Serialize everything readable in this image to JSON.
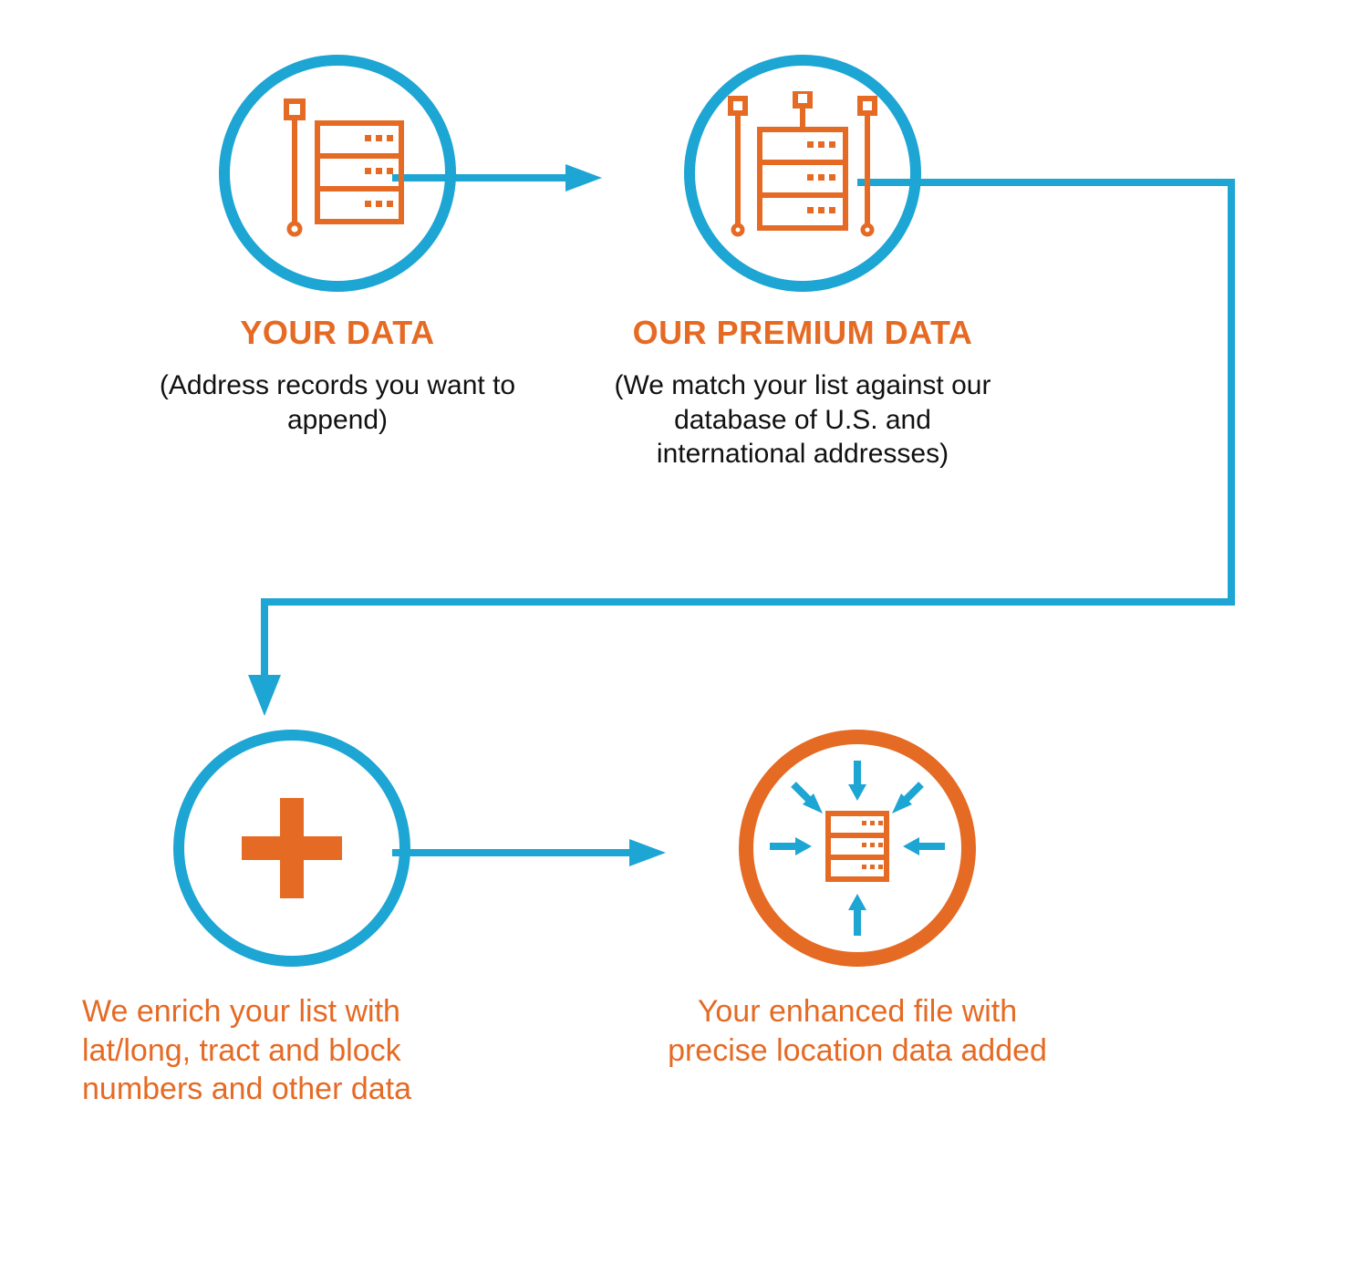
{
  "colors": {
    "blue": "#1DA5D4",
    "orange": "#E56A24",
    "black": "#111111"
  },
  "steps": [
    {
      "id": "your-data",
      "title": "YOUR DATA",
      "subtitle": "(Address records you want to append)",
      "icon": "server-single",
      "circle_color": "blue"
    },
    {
      "id": "our-premium-data",
      "title": "OUR PREMIUM DATA",
      "subtitle": "(We match your list against our database of U.S. and international addresses)",
      "icon": "server-multi",
      "circle_color": "blue"
    },
    {
      "id": "enrich",
      "subtitle": "We enrich your list with lat/long, tract and block numbers and other data",
      "icon": "plus",
      "circle_color": "blue"
    },
    {
      "id": "result",
      "subtitle": "Your enhanced file with precise location data added",
      "icon": "server-arrows-in",
      "circle_color": "orange"
    }
  ],
  "flow": [
    "your-data",
    "our-premium-data",
    "enrich",
    "result"
  ]
}
